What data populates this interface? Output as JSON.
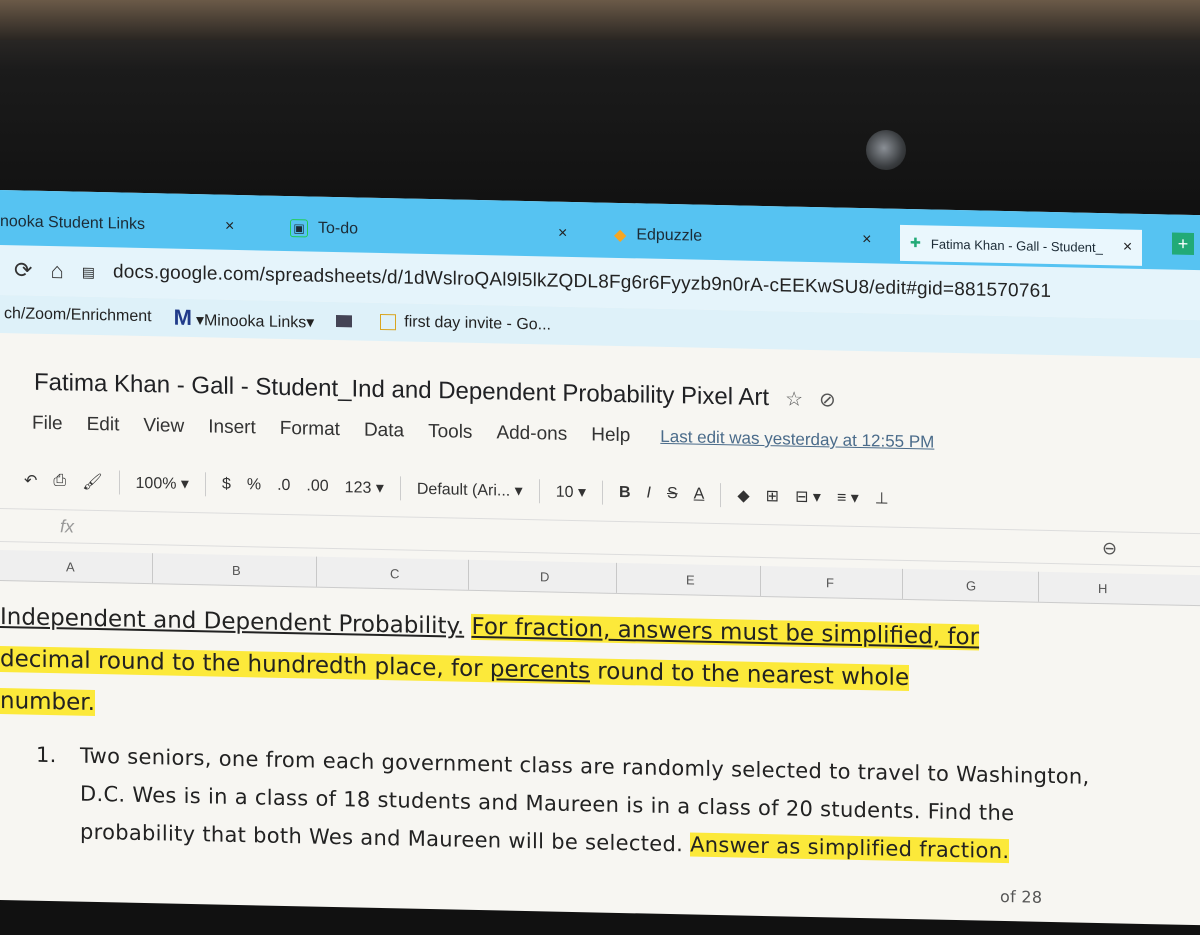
{
  "browser": {
    "tabs": [
      {
        "label": "nooka Student Links",
        "close": "×"
      },
      {
        "label": "To-do",
        "close": "×"
      },
      {
        "label": "Edpuzzle",
        "close": "×"
      },
      {
        "label": "Fatima Khan - Gall - Student_",
        "close": "×"
      }
    ],
    "new_tab_icon": "plus-icon",
    "url": "docs.google.com/spreadsheets/d/1dWslroQAl9l5lkZQDL8Fg6r6Fyyzb9n0rA-cEEKwSU8/edit#gid=881570761",
    "bookmarks": [
      {
        "label": "ch/Zoom/Enrichment"
      },
      {
        "label": "▾Minooka Links▾"
      },
      {
        "label": "first day invite - Go..."
      }
    ],
    "m_logo": "M"
  },
  "doc": {
    "title": "Fatima Khan - Gall - Student_Ind and Dependent Probability Pixel Art",
    "menu": [
      "File",
      "Edit",
      "View",
      "Insert",
      "Format",
      "Data",
      "Tools",
      "Add-ons",
      "Help"
    ],
    "last_edit": "Last edit was yesterday at 12:55 PM"
  },
  "toolbar": {
    "zoom": "100%",
    "currency": "$",
    "percent": "%",
    "dec_less": ".0",
    "dec_more": ".00",
    "format": "123",
    "font": "Default (Ari...",
    "font_size": "10",
    "bold": "B",
    "italic": "I",
    "strike": "S",
    "text_color": "A"
  },
  "formula_bar": {
    "fx": "fx"
  },
  "columns": [
    "A",
    "B",
    "C",
    "D",
    "E",
    "F",
    "G",
    "H"
  ],
  "content": {
    "heading_part1": "Independent and Dependent Probability.",
    "heading_part2": "For fraction, answers must be simplified, for",
    "line2_part1": "decimal round to the hundredth place, for ",
    "line2_part2": "percents",
    "line2_part3": " round to the nearest whole",
    "line3": "number.",
    "q1_num": "1.",
    "q1_line1": "Two seniors, one from each government class are randomly selected to travel to Washington,",
    "q1_line2": "D.C. Wes is in a class of 18 students and Maureen is in a class of 20 students.  Find the",
    "q1_line3a": "probability that both Wes and Maureen will be selected. ",
    "q1_line3b": "Answer as simplified fraction.",
    "partial": "of 28"
  },
  "colors": {
    "tab_bar": "#56c3f2",
    "highlight": "#fce93a"
  }
}
